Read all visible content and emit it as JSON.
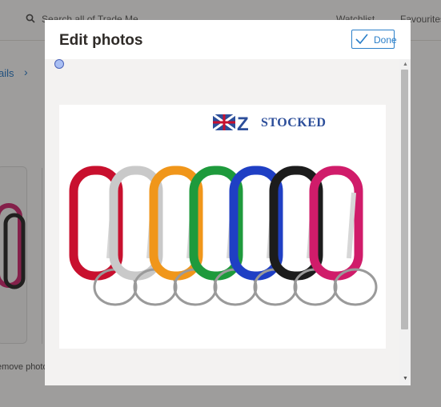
{
  "background": {
    "search_placeholder": "Search all of Trade Me",
    "watchlist_label": "Watchlist",
    "favourites_label": "Favourites",
    "breadcrumb_partial": "ails",
    "remove_photo_partial": "emove photo"
  },
  "modal": {
    "title": "Edit photos",
    "done_label": "Done"
  },
  "photo": {
    "logo_text": "STOCKED",
    "logo_letters": "NZ",
    "carabiner_colors": [
      "#c8102e",
      "#c9c9c9",
      "#f0961a",
      "#1e9a3c",
      "#1f3fc4",
      "#1c1c1c",
      "#d01c6a"
    ]
  },
  "colors": {
    "accent": "#2a7fc9",
    "title": "#2f2b28",
    "logo": "#2c4e9a"
  }
}
